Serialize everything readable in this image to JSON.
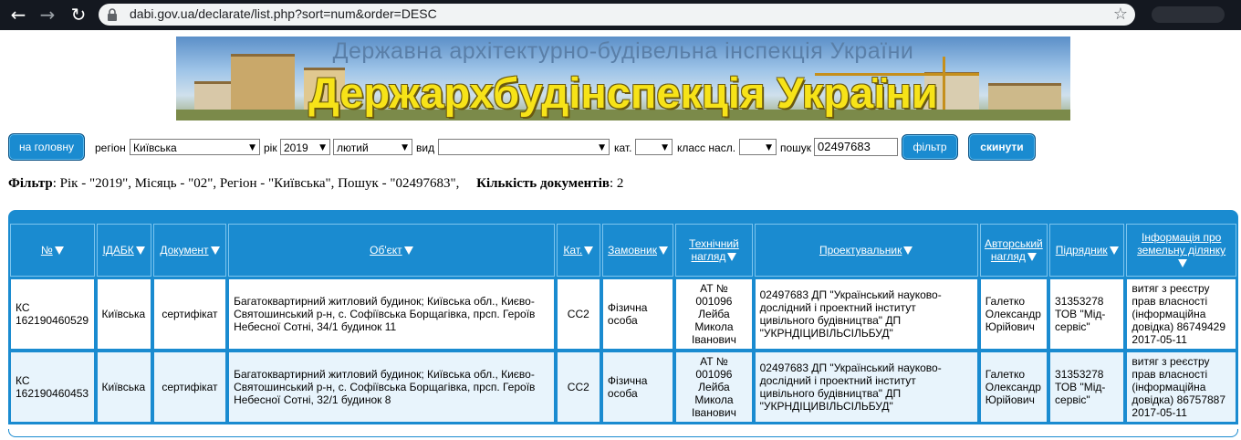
{
  "browser": {
    "url": "dabi.gov.ua/declarate/list.php?sort=num&order=DESC",
    "back_icon": "back-arrow-icon",
    "forward_icon": "forward-arrow-icon",
    "reload_icon": "reload-icon"
  },
  "banner": {
    "subtitle": "Державна архітектурно-будівельна інспекція України",
    "title": "Держархбудінспекція України"
  },
  "toolbar": {
    "home_label": "на головну",
    "region_label": "регіон",
    "region_value": "Київська",
    "year_label": "рік",
    "year_value": "2019",
    "month_value": "лютий",
    "type_label": "вид",
    "type_value": "",
    "cat_label": "кат.",
    "cat_value": "",
    "class_label": "класс насл.",
    "class_value": "",
    "search_label": "пошук",
    "search_value": "02497683",
    "filter_label": "фільтр",
    "reset_label": "скинути"
  },
  "filter_summary": {
    "label": "Фільтр",
    "text": ": Рік - \"2019\", Місяць - \"02\", Регіон - \"Київська\", Пошук - \"02497683\",",
    "count_label": "Кількість документів",
    "count_value": ": 2"
  },
  "table": {
    "headers": [
      "№",
      "IДАБК",
      "Документ",
      "Об'єкт",
      "Кат.",
      "Замовник",
      "Технічний нагляд",
      "Проектувальник",
      "Авторський нагляд",
      "Підрядник",
      "Інформація про земельну ділянку"
    ],
    "rows": [
      {
        "num": "КС 162190460529",
        "idabk": "Київська",
        "document": "сертифікат",
        "object": "Багатоквартирний житловий будинок; Київська обл., Києво-Святошинський р-н, с. Софіївська Борщагівка, прсп. Героїв Небесної Сотні, 34/1 будинок 11",
        "cat": "СС2",
        "customer": "Фізична особа",
        "tech": "АТ № 001096 Лейба Микола Іванович",
        "designer": "02497683 ДП \"Український науково-дослідний і проектний інститут цивільного будівництва\" ДП \"УКРНДІЦИВІЛЬСІЛЬБУД\"",
        "author": "Галетко Олександр Юрійович",
        "contractor": "31353278 ТОВ \"Мід-сервіс\"",
        "land": "витяг з реєстру прав власності (інформаційна довідка) 86749429 2017-05-11"
      },
      {
        "num": "КС 162190460453",
        "idabk": "Київська",
        "document": "сертифікат",
        "object": "Багатоквартирний житловий будинок; Київська обл., Києво-Святошинський р-н, с. Софіївська Борщагівка, прсп. Героїв Небесної Сотні, 32/1 будинок 8",
        "cat": "СС2",
        "customer": "Фізична особа",
        "tech": "АТ № 001096 Лейба Микола Іванович",
        "designer": "02497683 ДП \"Український науково-дослідний і проектний інститут цивільного будівництва\" ДП \"УКРНДІЦИВІЛЬСІЛЬБУД\"",
        "author": "Галетко Олександр Юрійович",
        "contractor": "31353278 ТОВ \"Мід-сервіс\"",
        "land": "витяг з реєстру прав власності (інформаційна довідка) 86757887 2017-05-11"
      }
    ]
  }
}
